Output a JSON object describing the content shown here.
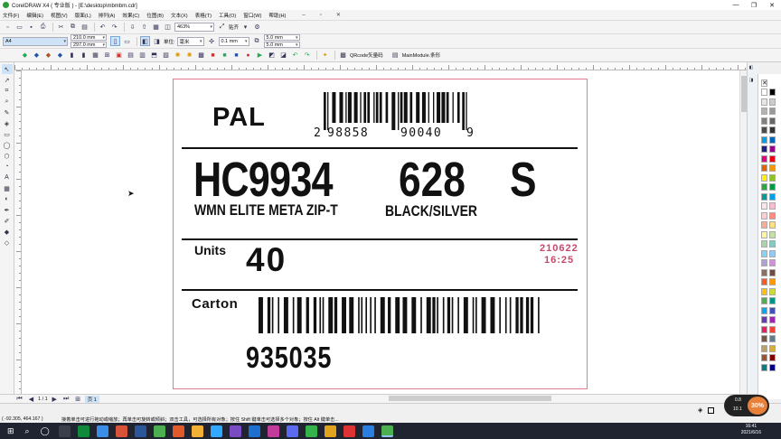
{
  "window": {
    "title": "CorelDRAW X4 ( 专业版 ) - [E:\\desktop\\mbmbm.cdr]",
    "controls": [
      "—",
      "❐",
      "✕"
    ]
  },
  "menubar": {
    "items": [
      "文件(F)",
      "编辑(E)",
      "视图(V)",
      "版面(L)",
      "排列(A)",
      "效果(C)",
      "位图(B)",
      "文本(X)",
      "表格(T)",
      "工具(O)",
      "窗口(W)",
      "帮助(H)"
    ],
    "window_controls": [
      "–",
      "▫",
      "✕"
    ]
  },
  "toolbar1": {
    "zoom": "463%",
    "snap_label": "贴齐"
  },
  "toolbar2": {
    "page_size": "A4",
    "width": "210.0 mm",
    "height": "297.0 mm",
    "units_label": "单位:",
    "units": "毫米",
    "nudge": "0.1 mm",
    "dup_x": "5.0 mm",
    "dup_y": "5.0 mm"
  },
  "toolbar3": {
    "qrcode_label": "QRcode矢量码",
    "module_label": "MainModule.条形"
  },
  "label_card": {
    "pal": "PAL",
    "barcode1_text": "2 988580 90040 9",
    "barcode1_digits": [
      "2",
      "98858",
      "90040",
      "9"
    ],
    "style": "HC9934",
    "color_code": "628",
    "size": "S",
    "description": "WMN ELITE META ZIP-T",
    "color_name": "BLACK/SILVER",
    "units_label": "Units",
    "units_value": "40",
    "date": "210622",
    "time": "16:25",
    "carton_label": "Carton",
    "carton_number": "935035"
  },
  "page_tabs": {
    "counter": "1 / 1",
    "tab": "页 1"
  },
  "statusbar": {
    "coords": "( -92.305, 464.167 )",
    "hint": "接着单击可进行拖动或缩放；再单击可旋转或倾斜；双击工具，可选择所有对象；按住 Shift 键单击可选择多个对象；按住 Alt 键单击..."
  },
  "taskbar": {
    "time": "16:41",
    "date": "2021/6/16"
  },
  "badge": {
    "percent": "30%",
    "up": "0.8",
    "down": "10.1"
  },
  "colors": {
    "page_border": "#e07a8e",
    "date_time": "#c8486a",
    "taskbar": "#1f2430"
  },
  "palette_colors": [
    "#ffffff",
    "#000000",
    "#e6e6e6",
    "#cccccc",
    "#b3b3b3",
    "#999999",
    "#808080",
    "#666666",
    "#4d4d4d",
    "#333333",
    "#00a0e9",
    "#0068b7",
    "#1d2088",
    "#920783",
    "#e4007f",
    "#e60012",
    "#eb6100",
    "#f39800",
    "#fff100",
    "#8fc31f",
    "#22ac38",
    "#009944",
    "#009e96",
    "#00a0e9",
    "#fce4ec",
    "#f8bbd0",
    "#ffcdd2",
    "#ff8a80",
    "#ffab91",
    "#ffe082",
    "#fff59d",
    "#c5e1a5",
    "#a5d6a7",
    "#80cbc4",
    "#81d4fa",
    "#90caf9",
    "#b39ddb",
    "#ce93d8",
    "#8d6e63",
    "#6d4c41",
    "#ff5722",
    "#ff9800",
    "#ffc107",
    "#cddc39",
    "#4caf50",
    "#009688",
    "#03a9f4",
    "#3f51b5",
    "#673ab7",
    "#9c27b0",
    "#e91e63",
    "#f44336",
    "#795548",
    "#607d8b",
    "#c0a060",
    "#d4af37",
    "#a0522d",
    "#800000",
    "#008080",
    "#000080"
  ]
}
